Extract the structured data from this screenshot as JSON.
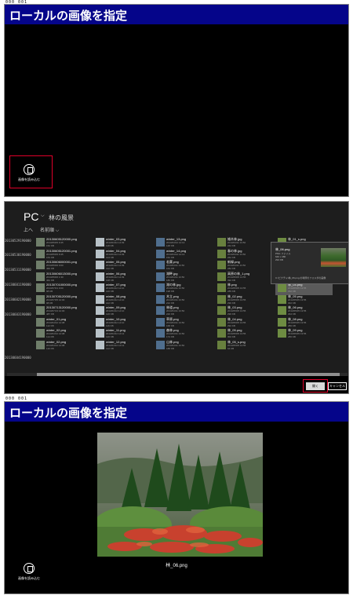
{
  "page_num_top": "000  001",
  "page_num_bottom": "000  001",
  "title": "ローカルの画像を指定",
  "load_button_label": "画像を読み込む",
  "picker": {
    "location": "PC",
    "folder": "林の風景",
    "up_label": "上へ",
    "sort_label": "名前順",
    "row_labels": [
      "20130529190000",
      "20130530190000",
      "20130531190000",
      "20130601190000",
      "20130602190000",
      "20130603190000",
      "20130604190000"
    ],
    "files": [
      [
        {
          "name": "20130605120000.png",
          "date": "2013/05/05 9:45",
          "size": "152 KB"
        },
        {
          "name": "winter_03.png",
          "date": "2013/04/12 14:09",
          "size": "118 KB"
        },
        {
          "name": "winter_13.png",
          "date": "2013/04/12 14:13",
          "size": "148 KB"
        },
        {
          "name": "雑木林.jpg",
          "date": "2013/04/11 13:50",
          "size": "242 KB"
        },
        {
          "name": "林_01_s.png",
          "date": "2013/05/05 13:55",
          "size": "42 KB"
        }
      ],
      [
        {
          "name": "20130605120001.png",
          "date": "2013/05/05 9:45",
          "size": "153 KB"
        },
        {
          "name": "winter_04.png",
          "date": "2013/04/12 14:09",
          "size": "124 KB"
        },
        {
          "name": "winter_14.png",
          "date": "2013/04/12 14:13",
          "size": "152 KB"
        },
        {
          "name": "春の林.jpg",
          "date": "2013/04/11 13:50",
          "size": "262 KB"
        },
        {
          "name": "林_02_s.png",
          "date": "2013/05/05 13:55",
          "size": "48 KB"
        }
      ],
      [
        {
          "name": "20130606000001.png",
          "date": "2013/05/06 0:00",
          "size": "460 KB"
        },
        {
          "name": "winter_05.png",
          "date": "2013/04/12 14:09",
          "size": "132 KB"
        },
        {
          "name": "若葉.png",
          "date": "2013/04/11 13:50",
          "size": "164 KB"
        },
        {
          "name": "新緑.png",
          "date": "2013/04/11 13:50",
          "size": "282 KB"
        },
        {
          "name": "林_03_s.png",
          "date": "2013/05/05 13:55",
          "size": "56 KB"
        }
      ],
      [
        {
          "name": "20130606013000.png",
          "date": "2013/05/06 1:30",
          "size": "462 KB"
        },
        {
          "name": "winter_06.png",
          "date": "2013/04/12 14:09",
          "size": "138 KB"
        },
        {
          "name": "湖畔.jpg",
          "date": "2013/04/11 13:50",
          "size": "186 KB"
        },
        {
          "name": "高原の林_1.png",
          "date": "2013/05/05 13:55",
          "size": "392 KB"
        },
        {
          "name": "林_06.png",
          "date": "2013/05/05 13:55",
          "size": "294 KB"
        }
      ],
      [
        {
          "name": "20130701000000.png",
          "date": "2013/07/01 0:00",
          "size": "98 KB"
        },
        {
          "name": "winter_07.png",
          "date": "2013/04/12 14:10",
          "size": "140 KB"
        },
        {
          "name": "湖の林.jpg",
          "date": "2013/04/11 13:50",
          "size": "198 KB"
        },
        {
          "name": "林.png",
          "date": "2013/05/05 13:55",
          "size": "285 KB"
        },
        {
          "name": "林_04.png",
          "date": "2013/05/05 13:55",
          "size": "292 KB"
        }
      ],
      [
        {
          "name": "20130705120000.png",
          "date": "2013/07/05 12:00",
          "size": "98 KB"
        },
        {
          "name": "winter_08.png",
          "date": "2013/04/12 14:10",
          "size": "142 KB"
        },
        {
          "name": "木立.png",
          "date": "2013/04/11 13:50",
          "size": "212 KB"
        },
        {
          "name": "林_02.png",
          "date": "2013/05/05 13:55",
          "size": "290 KB"
        },
        {
          "name": "林_05.png",
          "date": "2013/05/05 13:55",
          "size": "302 KB"
        }
      ],
      [
        {
          "name": "20130713120000.png",
          "date": "2013/07/13 12:00",
          "size": "487 KB"
        },
        {
          "name": "winter_09.png",
          "date": "2013/04/12 14:10",
          "size": "126 KB"
        },
        {
          "name": "林道.png",
          "date": "2013/04/11 13:50",
          "size": "220 KB"
        },
        {
          "name": "林_03.png",
          "date": "2013/05/05 13:55",
          "size": "296 KB"
        },
        {
          "name": "林_06.png",
          "date": "2013/05/05 13:55",
          "size": "294 KB"
        }
      ],
      [
        {
          "name": "winter_01.png",
          "date": "2013/04/12 14:08",
          "size": "112 KB"
        },
        {
          "name": "winter_10.png",
          "date": "2013/04/12 14:10",
          "size": "116 KB"
        },
        {
          "name": "草原.png",
          "date": "2013/04/11 13:50",
          "size": "168 KB"
        },
        {
          "name": "林_04.png",
          "date": "2013/05/05 13:55",
          "size": "292 KB"
        },
        {
          "name": "林_08.png",
          "date": "2013/05/05 13:55",
          "size": "280 KB"
        }
      ],
      [
        {
          "name": "winter_02.png",
          "date": "2013/04/12 14:08",
          "size": "114 KB"
        },
        {
          "name": "winter_11.png",
          "date": "2013/04/12 14:12",
          "size": "120 KB"
        },
        {
          "name": "森林.png",
          "date": "2013/04/11 13:50",
          "size": "174 KB"
        },
        {
          "name": "林_05.png",
          "date": "2013/05/05 13:55",
          "size": "302 KB"
        },
        {
          "name": "林_09.png",
          "date": "2013/05/05 13:55",
          "size": "286 KB"
        }
      ],
      [
        {
          "name": "winter_02.png",
          "date": "2013/04/12 14:08",
          "size": "116 KB"
        },
        {
          "name": "winter_12.png",
          "date": "2013/04/12 14:12",
          "size": "122 KB"
        },
        {
          "name": "山林.png",
          "date": "2013/04/11 13:50",
          "size": "188 KB"
        },
        {
          "name": "林_05_s.png",
          "date": "2013/05/05 13:55",
          "size": "64 KB"
        },
        {
          "name": "",
          "date": "",
          "size": ""
        }
      ]
    ],
    "tooltip": {
      "name": "林_06.png",
      "type": "PNG ファイル",
      "dimensions": "640 x 480",
      "size": "294 KB",
      "path": "C:\\ピクチャ\\林_06.png の場所のフォルダの画像"
    },
    "open_label": "開く",
    "cancel_label": "キャンセル"
  },
  "selected_caption": "林_06.png",
  "colors": {
    "title_bar": "#05058a",
    "highlight": "#e0002a",
    "picker_bg": "#1d1d1d"
  }
}
